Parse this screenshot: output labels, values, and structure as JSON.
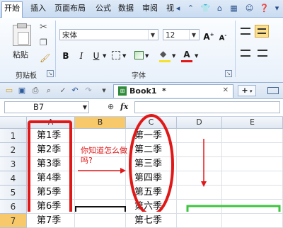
{
  "menu": {
    "tabs": [
      "开始",
      "插入",
      "页面布局",
      "公式",
      "数据",
      "审阅",
      "视"
    ]
  },
  "ribbon": {
    "clipboard": {
      "paste_label": "粘贴",
      "group_label": "剪贴板"
    },
    "font": {
      "font_name": "宋体",
      "font_size": "12",
      "bold": "B",
      "italic": "I",
      "underline": "U",
      "group_label": "字体",
      "grow": "A",
      "shrink": "A",
      "font_color": "A",
      "highlight_color": "#f5e12a",
      "font_color_value": "#e01818"
    }
  },
  "tabbar": {
    "doc_name": "Book1",
    "modified_mark": "*",
    "add": "+"
  },
  "formula_bar": {
    "name_box": "B7",
    "fx": "fx"
  },
  "sheet": {
    "columns": [
      "A",
      "B",
      "C",
      "D",
      "E"
    ],
    "rows": [
      "1",
      "2",
      "3",
      "4",
      "5",
      "6",
      "7"
    ],
    "col_a": [
      "第1季",
      "第2季",
      "第3季",
      "第4季",
      "第5季",
      "第6季",
      "第7季"
    ],
    "col_c": [
      "第一季",
      "第二季",
      "第三季",
      "第四季",
      "第五季",
      "第六季",
      "第七季"
    ],
    "annotation": "你知道怎么做吗?",
    "colors": {
      "annotation_red": "#e01818",
      "selection_green": "#3ec43e",
      "selected_header": "#f7c96b"
    }
  }
}
